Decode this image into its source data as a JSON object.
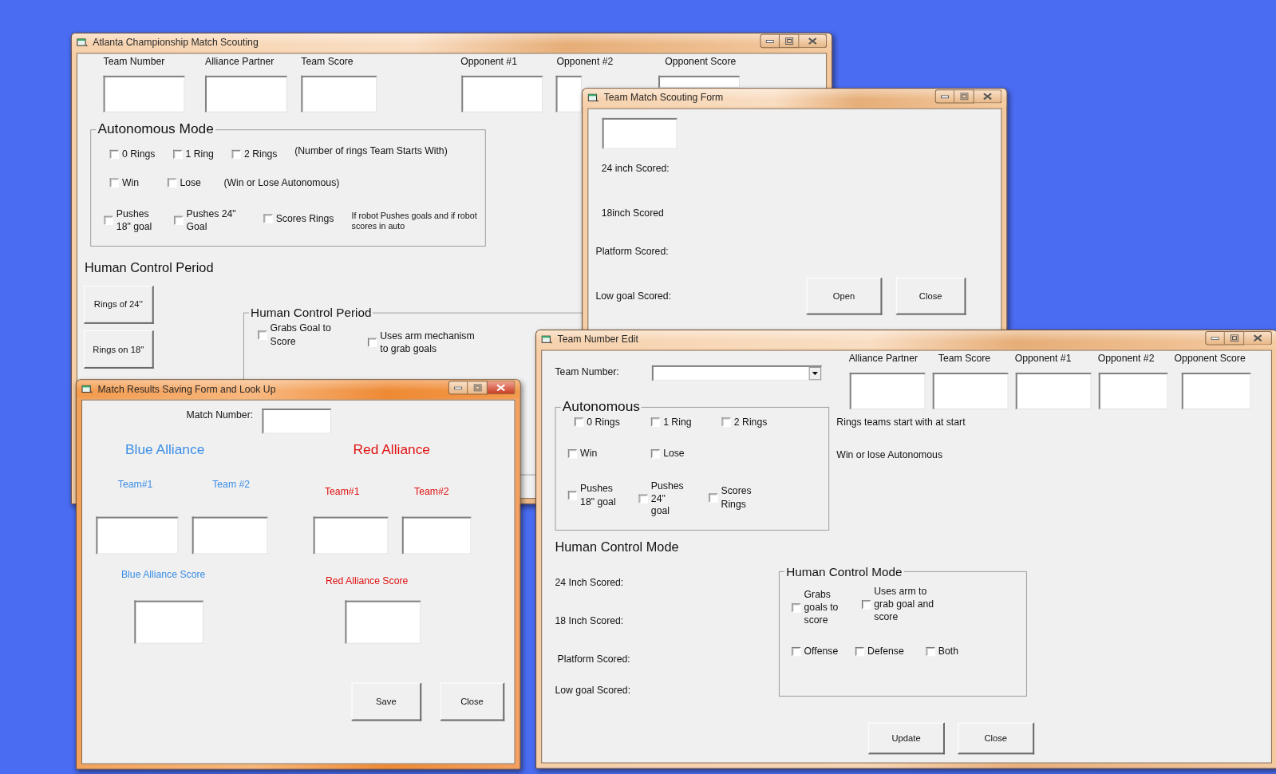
{
  "main_window": {
    "title": "Atlanta Championship Match Scouting",
    "active": false,
    "fields": [
      {
        "label": "Team Number"
      },
      {
        "label": "Alliance Partner"
      },
      {
        "label": "Team Score"
      },
      {
        "label": "Opponent #1"
      },
      {
        "label": "Opponent #2"
      },
      {
        "label": "Opponent Score"
      }
    ],
    "autonomous": {
      "legend": "Autonomous Mode",
      "checkboxes": [
        {
          "label": "0 Rings",
          "checked": false
        },
        {
          "label": "1 Ring",
          "checked": false
        },
        {
          "label": "2 Rings",
          "checked": false
        },
        {
          "label": "Win",
          "checked": false
        },
        {
          "label": "Lose",
          "checked": false
        },
        {
          "label": "Pushes 18\" goal",
          "checked": false
        },
        {
          "label": "Pushes 24\" Goal",
          "checked": false
        },
        {
          "label": "Scores Rings",
          "checked": false
        }
      ],
      "notes": [
        "(Number of rings Team Starts With)",
        "(Win or Lose Autonomous)",
        "If robot Pushes goals and if robot scores in auto"
      ]
    },
    "heading": "Human Control Period",
    "buttons": [
      "Rings of 24''",
      "Rings on 18''"
    ],
    "human_group": {
      "legend": "Human Control Period",
      "checkboxes": [
        {
          "label": "Grabs Goal to Score",
          "checked": false
        },
        {
          "label": "Uses arm mechanism to grab goals",
          "checked": false
        }
      ]
    }
  },
  "scouting_form": {
    "title": "Team Match Scouting Form",
    "active": false,
    "labels": [
      "24 inch Scored:",
      "18inch Scored",
      "Platform Scored:",
      "Low goal Scored:"
    ],
    "buttons": [
      "Open",
      "Close"
    ]
  },
  "edit_form": {
    "title": "Team Number Edit",
    "active": false,
    "team_number_label": "Team Number:",
    "top_fields": [
      {
        "label": "Alliance Partner"
      },
      {
        "label": "Team Score"
      },
      {
        "label": "Opponent #1"
      },
      {
        "label": "Opponent #2"
      },
      {
        "label": "Opponent Score"
      }
    ],
    "autonomous": {
      "legend": "Autonomous",
      "checkboxes": [
        {
          "label": "0 Rings",
          "checked": false
        },
        {
          "label": "1 Ring",
          "checked": false
        },
        {
          "label": "2 Rings",
          "checked": false
        },
        {
          "label": "Win",
          "checked": false
        },
        {
          "label": "Lose",
          "checked": false
        },
        {
          "label": "Pushes 18\" goal",
          "checked": false
        },
        {
          "label": "Pushes 24\" goal",
          "checked": false
        },
        {
          "label": "Scores Rings",
          "checked": false
        }
      ]
    },
    "notes": [
      "Rings teams start with at start",
      "Win or lose Autonomous"
    ],
    "heading": "Human Control Mode",
    "score_labels": [
      "24 Inch Scored:",
      "18 Inch Scored:",
      "Platform Scored:",
      "Low goal Scored:"
    ],
    "human_group": {
      "legend": "Human Control Mode",
      "checkboxes": [
        {
          "label": "Grabs goals to score",
          "checked": false
        },
        {
          "label": "Uses arm to grab goal and score",
          "checked": false
        },
        {
          "label": "Offense",
          "checked": false
        },
        {
          "label": "Defense",
          "checked": false
        },
        {
          "label": "Both",
          "checked": false
        }
      ]
    },
    "buttons": [
      "Update",
      "Close"
    ]
  },
  "results_form": {
    "title": "Match Results Saving Form and Look Up",
    "active": true,
    "match_number_label": "Match Number:",
    "alliances": [
      {
        "name": "Blue Alliance",
        "color": "#3a8ee6",
        "team_labels": [
          "Team#1",
          "Team #2"
        ],
        "score_label": "Blue Alliance Score"
      },
      {
        "name": "Red Alliance",
        "color": "#e01010",
        "team_labels": [
          "Team#1",
          "Team#2"
        ],
        "score_label": "Red Alliance Score"
      }
    ],
    "buttons": [
      "Save",
      "Close"
    ]
  }
}
